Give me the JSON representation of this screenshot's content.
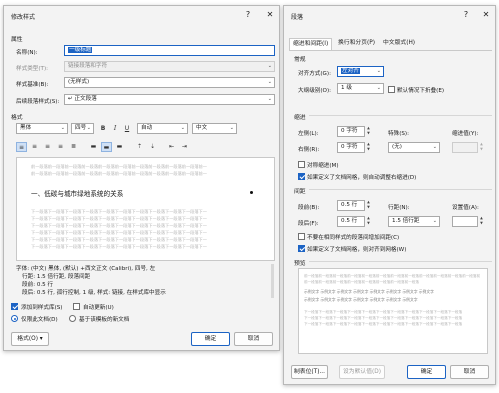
{
  "style_dialog": {
    "title": "修改样式",
    "help_icon": "?",
    "close_icon": "✕",
    "properties_label": "属性",
    "name_label": "名称(N):",
    "name_value": "一级标题",
    "style_type_label": "样式类型(T):",
    "style_type_value": "链接段落和字符",
    "based_on_label": "样式基准(B):",
    "based_on_value": "(无样式)",
    "next_style_label": "后续段落样式(S):",
    "next_style_value": "↵ 正文段落",
    "format_label": "格式",
    "font_value": "黑体",
    "size_value": "四号",
    "bold": "B",
    "italic": "I",
    "underline": "U",
    "color_value": "自动",
    "lang_value": "中文",
    "preview_prev_lines": [
      "前一段落前一段落前一段落前一段落前一段落前一段落前一段落前一段落前一段落前一段落前一",
      "前一段落前一段落前一段落前一段落前一段落前一段落前一段落前一段落前一段落前一段落前一"
    ],
    "preview_sample": "一、低碳与城市绿地系统的关系",
    "preview_next_lines": [
      "下一段落下一段落下一段落下一段落下一段落下一段落下一段落下一段落下一段落下一段落下一",
      "下一段落下一段落下一段落下一段落下一段落下一段落下一段落下一段落下一段落下一段落下一",
      "下一段落下一段落下一段落下一段落下一段落下一段落下一段落下一段落下一段落下一段落下一",
      "下一段落下一段落下一段落下一段落下一段落下一段落下一段落下一段落下一段落下一段落下一",
      "下一段落下一段落下一段落下一段落下一段落下一段落下一段落下一段落下一段落下一段落下一",
      "下一段落下一段落下一段落下一段落下一段落下一段落下一段落下一段落下一段落下一段落下一"
    ],
    "description_lines": [
      "字体: (中文) 黑体, (默认) +西文正文 (Calibri), 四号, 左",
      "行距: 1.5 倍行距, 段落间距",
      "段前: 0.5 行",
      "段后: 0.5 行, 孤行控制, 1 级, 样式: 链接, 在样式库中显示"
    ],
    "add_to_gallery": "添加到样式库(S)",
    "auto_update": "自动更新(U)",
    "only_this_doc": "仅限此文档(D)",
    "new_docs_template": "基于该模板的新文档",
    "format_button": "格式(O) ▾",
    "ok": "确定",
    "cancel": "取消"
  },
  "paragraph_dialog": {
    "title": "段落",
    "help_icon": "?",
    "close_icon": "✕",
    "tabs": [
      "缩进和间距(I)",
      "换行和分页(P)",
      "中文版式(H)"
    ],
    "general_label": "常规",
    "alignment_label": "对齐方式(G):",
    "alignment_value": "左对齐",
    "outline_label": "大纲级别(O):",
    "outline_value": "1 级",
    "collapsed_default": "默认情况下折叠(E)",
    "indent_label": "缩进",
    "left_label": "左侧(L):",
    "left_value": "0 字符",
    "right_label": "右侧(R):",
    "right_value": "0 字符",
    "special_label": "特殊(S):",
    "special_value": "(无)",
    "indent_value_label": "缩进值(Y):",
    "mirror_indent": "对称缩进(M)",
    "auto_right_indent": "如果定义了文档网格，则自动调整右缩进(D)",
    "spacing_label": "间距",
    "before_label": "段前(B):",
    "before_value": "0.5 行",
    "after_label": "段后(F):",
    "after_value": "0.5 行",
    "line_spacing_label": "行距(N):",
    "line_spacing_value": "1.5 倍行距",
    "set_value_label": "设置值(A):",
    "no_space_same_style": "不要在相同样式的段落间增加间距(C)",
    "snap_to_grid": "如果定义了文档网格，则对齐到网格(W)",
    "preview_label": "预览",
    "preview_lines": [
      "前一段落前一段落前一段落前一段落前一段落前一段落前一段落前一段落前一段落前一段落前一段落前一段落前",
      "前一段落前一段落前一段落前一段落前一段落前一段落前一段落前一段落",
      "示例文字 示例文字 示例文字 示例文字 示例文字 示例文字 示例文字 示例文字",
      "示例文字 示例文字 示例文字 示例文字 示例文字 示例文字 示例文字",
      "下一段落下一段落下一段落下一段落下一段落下一段落下一段落下一段落下一段落下一段落下一段落",
      "下一段落下一段落下一段落下一段落下一段落下一段落下一段落下一段落下一段落下一段落下一段落",
      "下一段落下一段落下一段落下一段落下一段落下一段落下一段落下一段落下一段落下一段落下一段落"
    ],
    "tabs_button": "制表位(T)...",
    "set_default_button": "设为默认值(D)",
    "ok": "确定",
    "cancel": "取消"
  },
  "colors": {
    "accent": "#1c63c4",
    "dialog_bg": "#f3f3f3"
  }
}
